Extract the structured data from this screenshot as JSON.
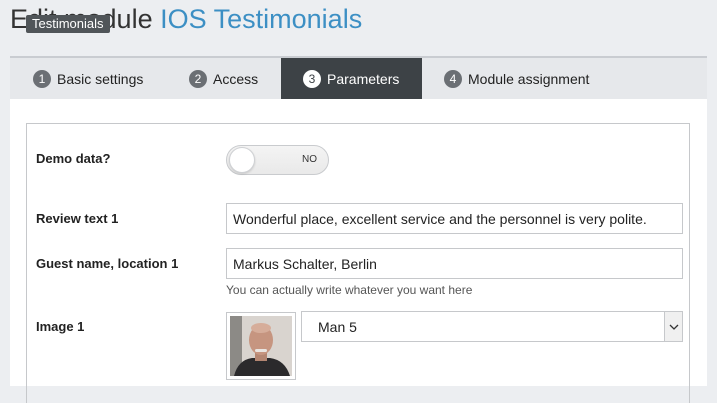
{
  "header": {
    "title_prefix": "Edit module",
    "module_name": "IOS Testimonials"
  },
  "tabs": [
    {
      "number": "1",
      "label": "Basic settings",
      "active": false
    },
    {
      "number": "2",
      "label": "Access",
      "active": false
    },
    {
      "number": "3",
      "label": "Parameters",
      "active": true
    },
    {
      "number": "4",
      "label": "Module assignment",
      "active": false
    }
  ],
  "fieldset": {
    "legend": "Testimonials"
  },
  "fields": {
    "demo_data": {
      "label": "Demo data?",
      "state": "NO"
    },
    "review_text_1": {
      "label": "Review text 1",
      "value": "Wonderful place, excellent service and the personnel is very polite."
    },
    "guest_name_1": {
      "label": "Guest name, location 1",
      "value": "Markus Schalter, Berlin",
      "help": "You can actually write whatever you want here"
    },
    "image_1": {
      "label": "Image 1",
      "selected": "Man 5"
    }
  },
  "colors": {
    "accent": "#3c8fc4",
    "active_tab": "#3d4246",
    "legend_bg": "#505559"
  }
}
